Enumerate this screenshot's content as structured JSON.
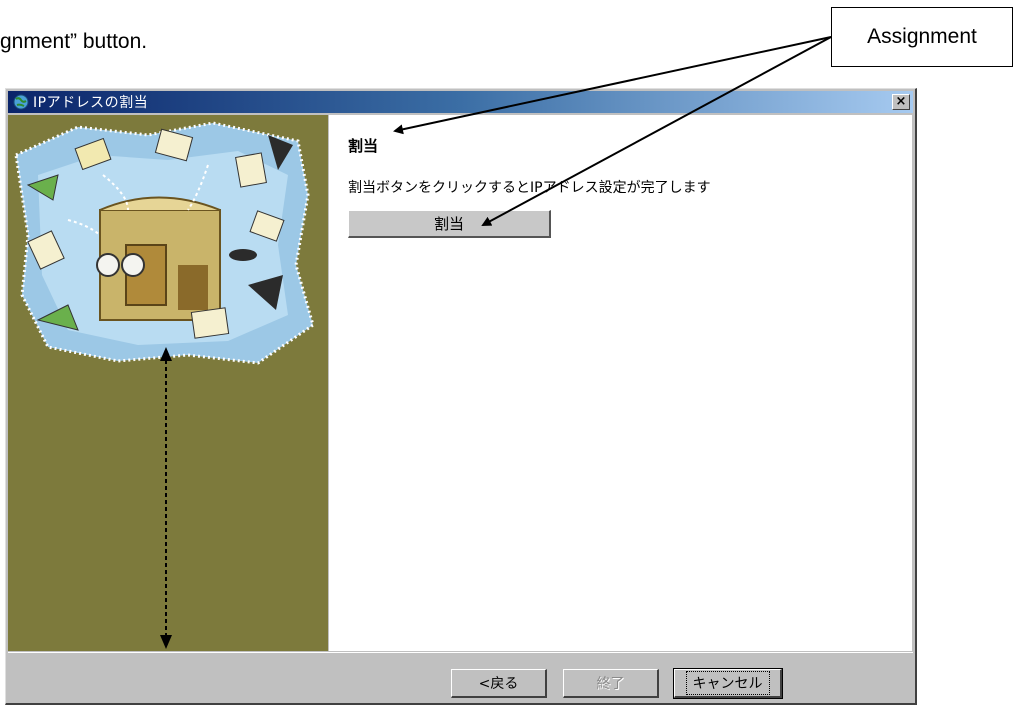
{
  "caption": "gnment” button.",
  "callout": {
    "label": "Assignment"
  },
  "window": {
    "title": "IPアドレスの割当",
    "close_glyph": "×"
  },
  "main": {
    "heading": "割当",
    "instruction": "割当ボタンをクリックするとIPアドレス設定が完了します",
    "assign_button_label": "割当"
  },
  "footer": {
    "back_label": "<戻る",
    "finish_label": "終了",
    "cancel_label": "キャンセル"
  },
  "colors": {
    "title_bar_start": "#0a246a",
    "left_panel": "#7d7a3c",
    "button_face": "#c0c0c0"
  }
}
